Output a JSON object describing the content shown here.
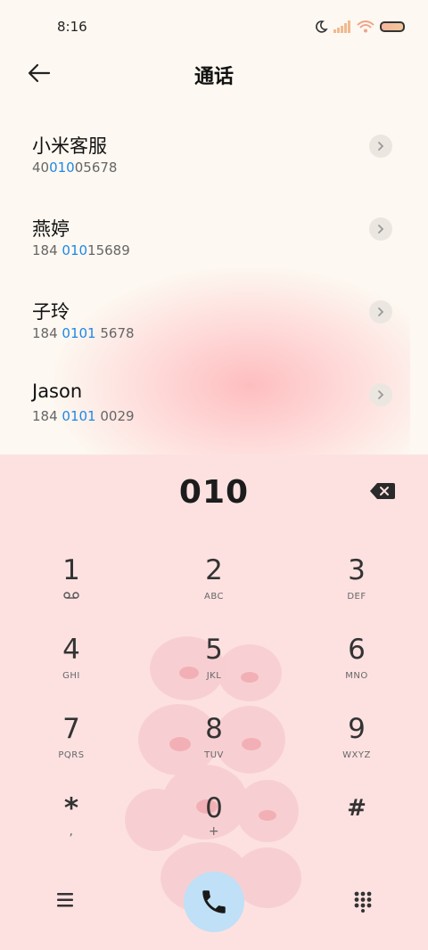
{
  "status_bar": {
    "time": "8:16"
  },
  "header": {
    "title": "通话"
  },
  "contacts": [
    {
      "name": "小米客服",
      "number_pre": "40",
      "number_match": "010",
      "number_post": "05678"
    },
    {
      "name": "燕婷",
      "number_pre": "184 ",
      "number_match": "010",
      "number_post": "15689"
    },
    {
      "name": "子玲",
      "number_pre": "184 ",
      "number_match": "0101",
      "number_post": " 5678"
    },
    {
      "name": "Jason",
      "number_pre": "184 ",
      "number_match": "0101",
      "number_post": " 0029"
    }
  ],
  "dialer": {
    "input": "010",
    "keys": [
      {
        "digit": "1",
        "letters": ""
      },
      {
        "digit": "2",
        "letters": "ABC"
      },
      {
        "digit": "3",
        "letters": "DEF"
      },
      {
        "digit": "4",
        "letters": "GHI"
      },
      {
        "digit": "5",
        "letters": "JKL"
      },
      {
        "digit": "6",
        "letters": "MNO"
      },
      {
        "digit": "7",
        "letters": "PQRS"
      },
      {
        "digit": "8",
        "letters": "TUV"
      },
      {
        "digit": "9",
        "letters": "WXYZ"
      },
      {
        "digit": "*",
        "letters": ","
      },
      {
        "digit": "0",
        "letters": "+"
      },
      {
        "digit": "#",
        "letters": ""
      }
    ]
  },
  "colors": {
    "highlight": "#1e88e5",
    "call_button": "#bfe0f6",
    "dialer_bg": "#fde1e1"
  }
}
